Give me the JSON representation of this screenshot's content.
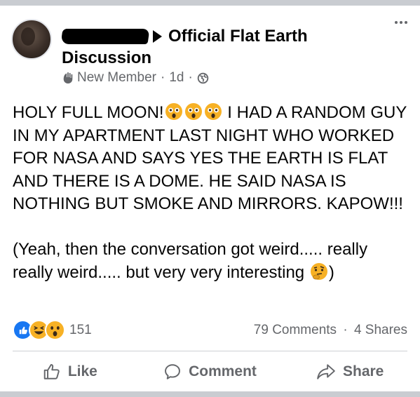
{
  "post": {
    "author_redacted": true,
    "group_name_line1": "Official Flat Earth",
    "group_name_line2": "Discussion",
    "member_badge": "New Member",
    "time": "1d",
    "separator": "·",
    "privacy_icon": "globe-icon",
    "body": {
      "p1_part1": "HOLY FULL MOON!",
      "p1_part2": " I HAD A RANDOM GUY IN MY APARTMENT LAST NIGHT WHO WORKED FOR NASA AND SAYS YES THE EARTH IS FLAT AND THERE IS A DOME. HE SAID NASA IS NOTHING BUT SMOKE AND MIRRORS. KAPOW!!!",
      "p2_part1": "(Yeah, then the conversation got weird..... really really weird..... but very very interesting ",
      "p2_part2": ")"
    },
    "emojis_after_title": [
      "astonished-face",
      "astonished-face",
      "astonished-face"
    ],
    "emoji_in_p2": "thinking-face"
  },
  "stats": {
    "reaction_icons": [
      "like",
      "haha",
      "wow"
    ],
    "reaction_count": "151",
    "comments": "79 Comments",
    "shares": "4 Shares"
  },
  "actions": {
    "like": "Like",
    "comment": "Comment",
    "share": "Share"
  },
  "colors": {
    "text": "#050505",
    "secondary": "#65676b",
    "like_blue": "#1877f2",
    "emoji_yellow": "#f7b125"
  }
}
